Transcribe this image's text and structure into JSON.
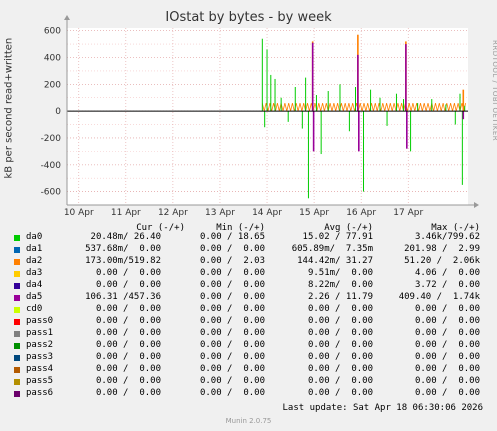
{
  "chart_data": {
    "type": "line",
    "title": "IOstat by bytes - by week",
    "ylabel": "kB per second read+written",
    "watermark": "RRDTOOL / TOBI OETIKER",
    "ylim": [
      -700,
      620
    ],
    "yticks": [
      600,
      400,
      200,
      0,
      -200,
      -400,
      -600
    ],
    "xlabels": [
      "10 Apr",
      "11 Apr",
      "12 Apr",
      "13 Apr",
      "14 Apr",
      "15 Apr",
      "16 Apr",
      "17 Apr"
    ],
    "x_start_day": 9.75,
    "x_end_day": 18.27,
    "data_start_day": 13.9,
    "series": [
      {
        "name": "da0",
        "color": "#00cc00",
        "spikes": [
          {
            "day": 13.9,
            "value": 540
          },
          {
            "day": 13.95,
            "value": -120
          },
          {
            "day": 14.0,
            "value": 460
          },
          {
            "day": 14.08,
            "value": 270
          },
          {
            "day": 14.17,
            "value": 240
          },
          {
            "day": 14.3,
            "value": 100
          },
          {
            "day": 14.45,
            "value": -80
          },
          {
            "day": 14.6,
            "value": 180
          },
          {
            "day": 14.75,
            "value": -130
          },
          {
            "day": 14.82,
            "value": 250
          },
          {
            "day": 14.88,
            "value": -650
          },
          {
            "day": 15.05,
            "value": 120
          },
          {
            "day": 15.15,
            "value": -320
          },
          {
            "day": 15.3,
            "value": 150
          },
          {
            "day": 15.55,
            "value": 200
          },
          {
            "day": 15.75,
            "value": -150
          },
          {
            "day": 15.88,
            "value": 180
          },
          {
            "day": 16.05,
            "value": -600
          },
          {
            "day": 16.2,
            "value": 160
          },
          {
            "day": 16.4,
            "value": 100
          },
          {
            "day": 16.55,
            "value": -110
          },
          {
            "day": 16.75,
            "value": 130
          },
          {
            "day": 16.9,
            "value": 90
          },
          {
            "day": 17.05,
            "value": -300
          },
          {
            "day": 17.2,
            "value": 60
          },
          {
            "day": 17.5,
            "value": 90
          },
          {
            "day": 17.8,
            "value": 50
          },
          {
            "day": 18.0,
            "value": -100
          },
          {
            "day": 18.1,
            "value": 130
          },
          {
            "day": 18.15,
            "value": -550
          },
          {
            "day": 18.2,
            "value": 40
          }
        ]
      },
      {
        "name": "da2",
        "color": "#ff8000",
        "spikes": [
          {
            "day": 14.97,
            "value": 520
          },
          {
            "day": 15.93,
            "value": 570
          },
          {
            "day": 16.95,
            "value": 520
          },
          {
            "day": 18.17,
            "value": 160
          }
        ]
      },
      {
        "name": "da5",
        "color": "#990099",
        "spikes": [
          {
            "day": 14.97,
            "value": 510
          },
          {
            "day": 14.99,
            "value": -300
          },
          {
            "day": 15.93,
            "value": 420
          },
          {
            "day": 15.95,
            "value": -300
          },
          {
            "day": 16.95,
            "value": 500
          },
          {
            "day": 16.97,
            "value": -280
          },
          {
            "day": 18.17,
            "value": -60
          }
        ]
      }
    ],
    "oscillation_color": "#ff8000",
    "oscillation_amplitude": 60
  },
  "legend": {
    "headers": [
      "Cur (-/+)",
      "Min (-/+)",
      "Avg (-/+)",
      "Max (-/+)"
    ],
    "rows": [
      {
        "name": "da0",
        "color": "#00cc00",
        "cur": "20.48m/ 26.40",
        "min": "0.00 / 18.65",
        "avg": "15.02 / 77.91",
        "max": "3.46k/799.62"
      },
      {
        "name": "da1",
        "color": "#0066b3",
        "cur": "537.68m/  0.00",
        "min": "0.00 /  0.00",
        "avg": "605.89m/  7.35m",
        "max": "201.98 /  2.99"
      },
      {
        "name": "da2",
        "color": "#ff8000",
        "cur": "173.00m/519.82",
        "min": "0.00 /  2.03",
        "avg": "144.42m/ 31.27",
        "max": "51.20 /  2.06k"
      },
      {
        "name": "da3",
        "color": "#ffcc00",
        "cur": "0.00 /  0.00",
        "min": "0.00 /  0.00",
        "avg": "9.51m/  0.00",
        "max": "4.06 /  0.00"
      },
      {
        "name": "da4",
        "color": "#330099",
        "cur": "0.00 /  0.00",
        "min": "0.00 /  0.00",
        "avg": "8.22m/  0.00",
        "max": "3.72 /  0.00"
      },
      {
        "name": "da5",
        "color": "#990099",
        "cur": "106.31 /457.36",
        "min": "0.00 /  0.00",
        "avg": "2.26 / 11.79",
        "max": "409.40 /  1.74k"
      },
      {
        "name": "cd0",
        "color": "#ccff00",
        "cur": "0.00 /  0.00",
        "min": "0.00 /  0.00",
        "avg": "0.00 /  0.00",
        "max": "0.00 /  0.00"
      },
      {
        "name": "pass0",
        "color": "#ff0000",
        "cur": "0.00 /  0.00",
        "min": "0.00 /  0.00",
        "avg": "0.00 /  0.00",
        "max": "0.00 /  0.00"
      },
      {
        "name": "pass1",
        "color": "#808080",
        "cur": "0.00 /  0.00",
        "min": "0.00 /  0.00",
        "avg": "0.00 /  0.00",
        "max": "0.00 /  0.00"
      },
      {
        "name": "pass2",
        "color": "#008f00",
        "cur": "0.00 /  0.00",
        "min": "0.00 /  0.00",
        "avg": "0.00 /  0.00",
        "max": "0.00 /  0.00"
      },
      {
        "name": "pass3",
        "color": "#00487d",
        "cur": "0.00 /  0.00",
        "min": "0.00 /  0.00",
        "avg": "0.00 /  0.00",
        "max": "0.00 /  0.00"
      },
      {
        "name": "pass4",
        "color": "#b35a00",
        "cur": "0.00 /  0.00",
        "min": "0.00 /  0.00",
        "avg": "0.00 /  0.00",
        "max": "0.00 /  0.00"
      },
      {
        "name": "pass5",
        "color": "#b38f00",
        "cur": "0.00 /  0.00",
        "min": "0.00 /  0.00",
        "avg": "0.00 /  0.00",
        "max": "0.00 /  0.00"
      },
      {
        "name": "pass6",
        "color": "#6b006b",
        "cur": "0.00 /  0.00",
        "min": "0.00 /  0.00",
        "avg": "0.00 /  0.00",
        "max": "0.00 /  0.00"
      }
    ]
  },
  "last_update": "Last update: Sat Apr 18 06:30:06 2026",
  "munin_version": "Munin 2.0.75"
}
